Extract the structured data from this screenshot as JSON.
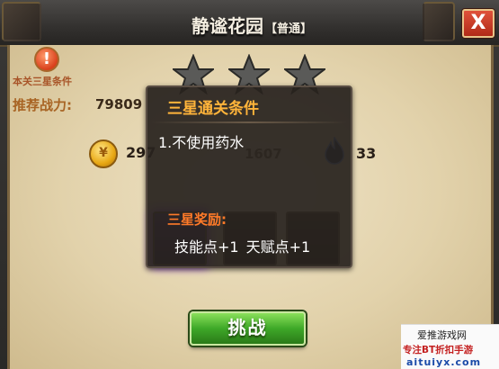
{
  "window": {
    "title": "静谧花园",
    "difficulty": "【普通】",
    "close_label": "X"
  },
  "stage": {
    "three_star_label": "本关三星条件",
    "warn_icon": "exclamation-icon",
    "recommended_power_label": "推荐战力:",
    "recommended_power_value": "79809",
    "stars": [
      "star-icon",
      "star-icon",
      "star-icon"
    ],
    "star_color": "#5a5a58"
  },
  "rewards": {
    "coin_value_visible": "297",
    "coin_icon": "gold-coin-icon",
    "middle_value_visible": "1607",
    "soul_value": "33",
    "soul_icon": "blue-flame-icon",
    "slots": [
      "slot-1",
      "slot-2",
      "slot-3"
    ]
  },
  "tooltip": {
    "title": "三星通关条件",
    "condition": "1.不使用药水",
    "reward_title": "三星奖励:",
    "reward_1": "技能点+1",
    "reward_2": "天赋点+1"
  },
  "actions": {
    "challenge_label": "挑战",
    "challenge_color": "#3ea828"
  },
  "watermark": {
    "line1": "爱推游戏网",
    "line2": "专注BT折扣手游",
    "line3": "aituiyx.com"
  }
}
